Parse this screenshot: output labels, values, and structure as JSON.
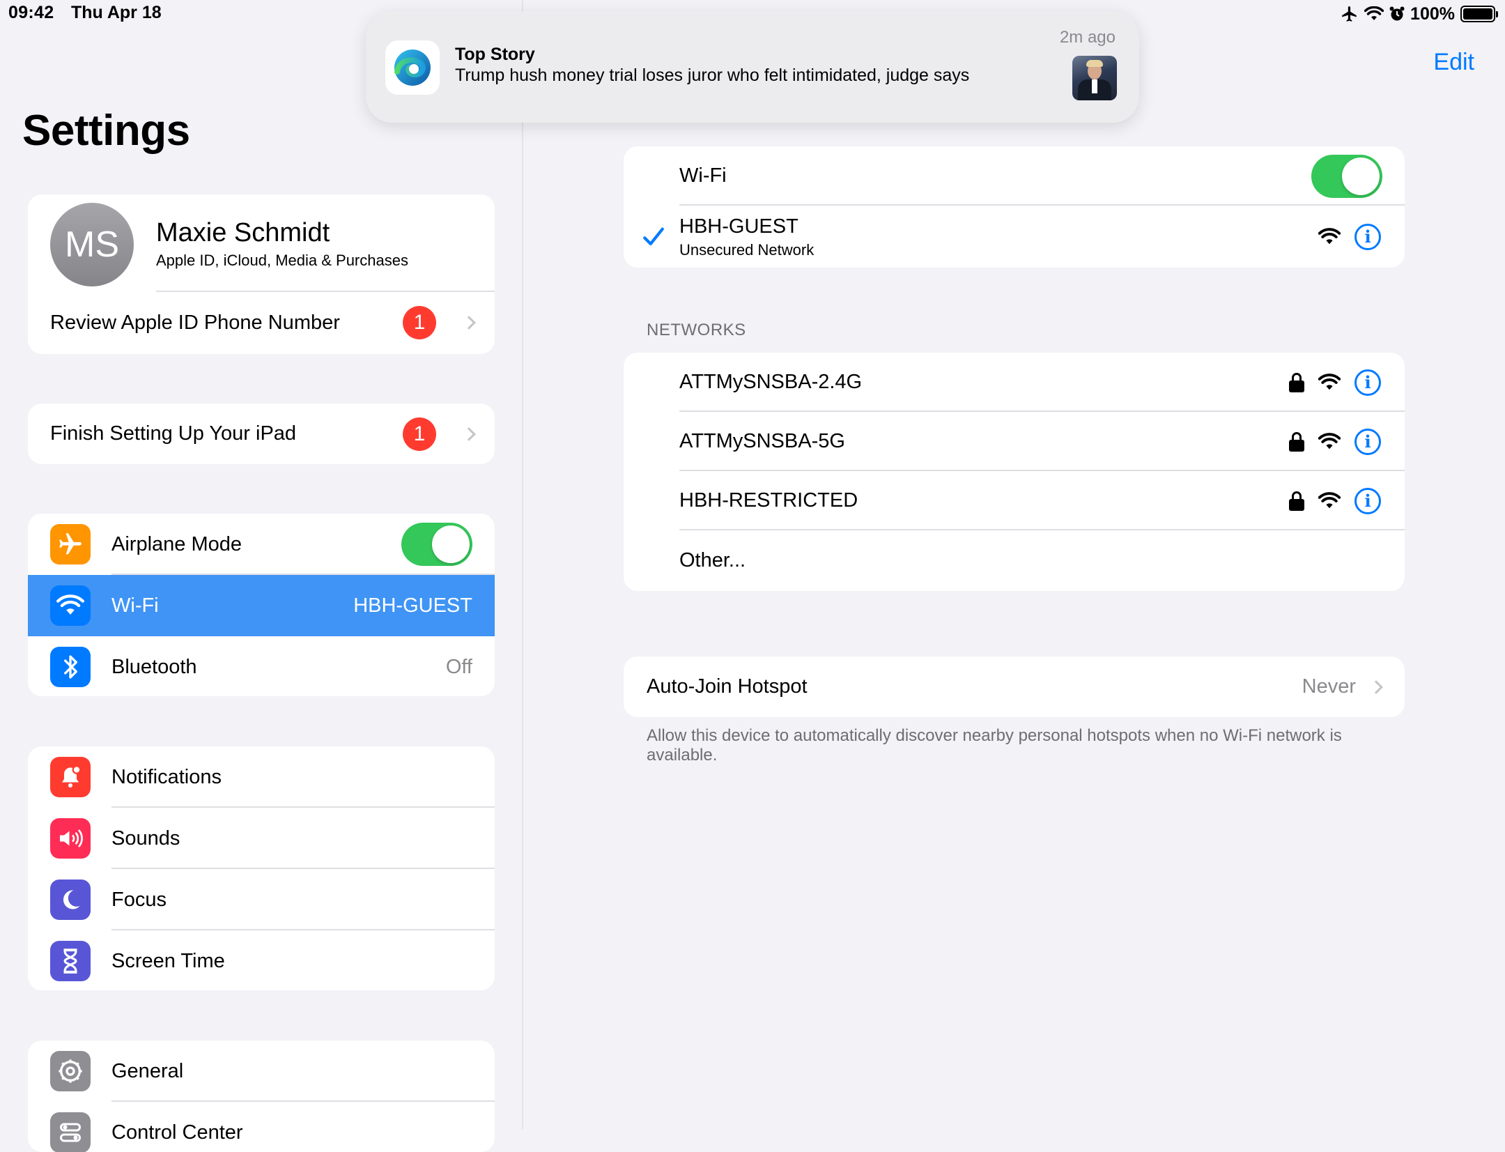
{
  "status_bar": {
    "time": "09:42",
    "date": "Thu Apr 18",
    "battery": "100%",
    "battery_level": 1.0
  },
  "notification": {
    "title": "Top Story",
    "body": "Trump hush money trial loses juror who felt intimidated, judge says",
    "time": "2m ago",
    "app_icon": "microsoft-edge-icon"
  },
  "nav": {
    "edit_label": "Edit"
  },
  "sidebar": {
    "title": "Settings",
    "profile": {
      "initials": "MS",
      "name": "Maxie Schmidt",
      "subtitle": "Apple ID, iCloud, Media & Purchases",
      "review_label": "Review Apple ID Phone Number",
      "review_badge": "1"
    },
    "setup": {
      "label": "Finish Setting Up Your iPad",
      "badge": "1"
    },
    "connectivity": [
      {
        "label": "Airplane Mode",
        "icon": "airplane-icon",
        "color": "#ff9500",
        "toggle_on": true
      },
      {
        "label": "Wi-Fi",
        "value": "HBH-GUEST",
        "icon": "wifi-icon",
        "color": "#007aff",
        "selected": true
      },
      {
        "label": "Bluetooth",
        "value": "Off",
        "icon": "bluetooth-icon",
        "color": "#007aff"
      }
    ],
    "alerts": [
      {
        "label": "Notifications",
        "icon": "bell-icon",
        "color": "#ff3b30"
      },
      {
        "label": "Sounds",
        "icon": "speaker-icon",
        "color": "#ff2d55"
      },
      {
        "label": "Focus",
        "icon": "moon-icon",
        "color": "#5856d6"
      },
      {
        "label": "Screen Time",
        "icon": "hourglass-icon",
        "color": "#5856d6"
      }
    ],
    "system": [
      {
        "label": "General",
        "icon": "gear-icon",
        "color": "#8e8e93"
      },
      {
        "label": "Control Center",
        "icon": "switches-icon",
        "color": "#8e8e93"
      }
    ]
  },
  "wifi": {
    "toggle_label": "Wi-Fi",
    "toggle_on": true,
    "connected": {
      "name": "HBH-GUEST",
      "subtitle": "Unsecured Network"
    },
    "networks_header": "NETWORKS",
    "networks": [
      {
        "name": "ATTMySNSBA-2.4G",
        "locked": true
      },
      {
        "name": "ATTMySNSBA-5G",
        "locked": true
      },
      {
        "name": "HBH-RESTRICTED",
        "locked": true
      }
    ],
    "other_label": "Other...",
    "auto_join": {
      "label": "Auto-Join Hotspot",
      "value": "Never",
      "footer": "Allow this device to automatically discover nearby personal hotspots when no Wi-Fi network is available."
    }
  }
}
